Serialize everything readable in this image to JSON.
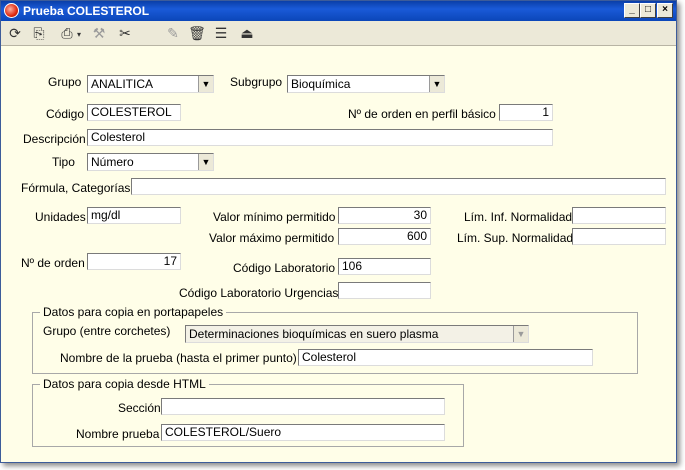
{
  "window": {
    "title": "Prueba COLESTEROL",
    "minimize": "_",
    "maximize": "□",
    "close": "×"
  },
  "toolbar": {
    "icons": [
      "refresh-icon",
      "copy-icon",
      "print-icon",
      "paint-icon",
      "tools-icon",
      "edit-icon",
      "trash-icon",
      "list-icon",
      "exit-icon"
    ],
    "glyphs": [
      "⟳",
      "⎘",
      "⎙",
      "⚒",
      "✂",
      "✎",
      "🗑",
      "☰",
      "⏏"
    ]
  },
  "form": {
    "grupo_label": "Grupo",
    "grupo_value": "ANALITICA",
    "subgrupo_label": "Subgrupo",
    "subgrupo_value": "Bioquímica",
    "codigo_label": "Código",
    "codigo_value": "COLESTEROL",
    "orden_perfil_label": "Nº de orden en perfil básico",
    "orden_perfil_value": "1",
    "descripcion_label": "Descripción",
    "descripcion_value": "Colesterol",
    "tipo_label": "Tipo",
    "tipo_value": "Número",
    "formula_label": "Fórmula, Categorías",
    "formula_value": "",
    "unidades_label": "Unidades",
    "unidades_value": "mg/dl",
    "valor_min_label": "Valor mínimo permitido",
    "valor_min_value": "30",
    "valor_max_label": "Valor máximo permitido",
    "valor_max_value": "600",
    "lim_inf_label": "Lím. Inf. Normalidad",
    "lim_inf_value": "",
    "lim_sup_label": "Lím. Sup. Normalidad",
    "lim_sup_value": "",
    "orden_label": "Nº de orden",
    "orden_value": "17",
    "cod_lab_label": "Código Laboratorio",
    "cod_lab_value": "106",
    "cod_lab_urg_label": "Código Laboratorio Urgencias",
    "cod_lab_urg_value": ""
  },
  "portapapeles": {
    "title": "Datos para copia en portapapeles",
    "grupo_label": "Grupo (entre corchetes)",
    "grupo_value": "Determinaciones bioquímicas en suero plasma",
    "nombre_label": "Nombre de la prueba (hasta el primer punto)",
    "nombre_value": "Colesterol"
  },
  "html_copy": {
    "title": "Datos para copia desde HTML",
    "seccion_label": "Sección",
    "seccion_value": "",
    "nombre_label": "Nombre prueba",
    "nombre_value": "COLESTEROL/Suero"
  },
  "dropdown_arrow": "▼"
}
